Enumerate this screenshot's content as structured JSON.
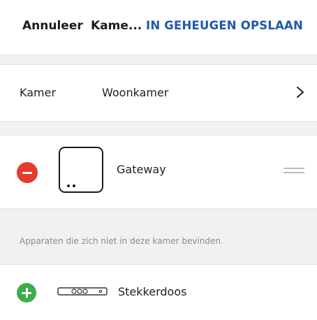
{
  "header": {
    "cancel_label": "Annuleer",
    "title": "Kame...",
    "save_label": "IN GEHEUGEN OPSLAAN"
  },
  "room": {
    "label": "Kamer",
    "value": "Woonkamer"
  },
  "devices_in_room": [
    {
      "name": "Gateway",
      "icon": "gateway-icon"
    }
  ],
  "other_devices_note": "Apparaten die zich niet in deze kamer bevinden.",
  "devices_not_in_room": [
    {
      "name": "Stekkerdoos",
      "icon": "power-strip-icon"
    }
  ],
  "colors": {
    "accent": "#1f5aa8",
    "remove": "#e53a2c",
    "add": "#3cae4a",
    "background": "#f1f1f1"
  }
}
